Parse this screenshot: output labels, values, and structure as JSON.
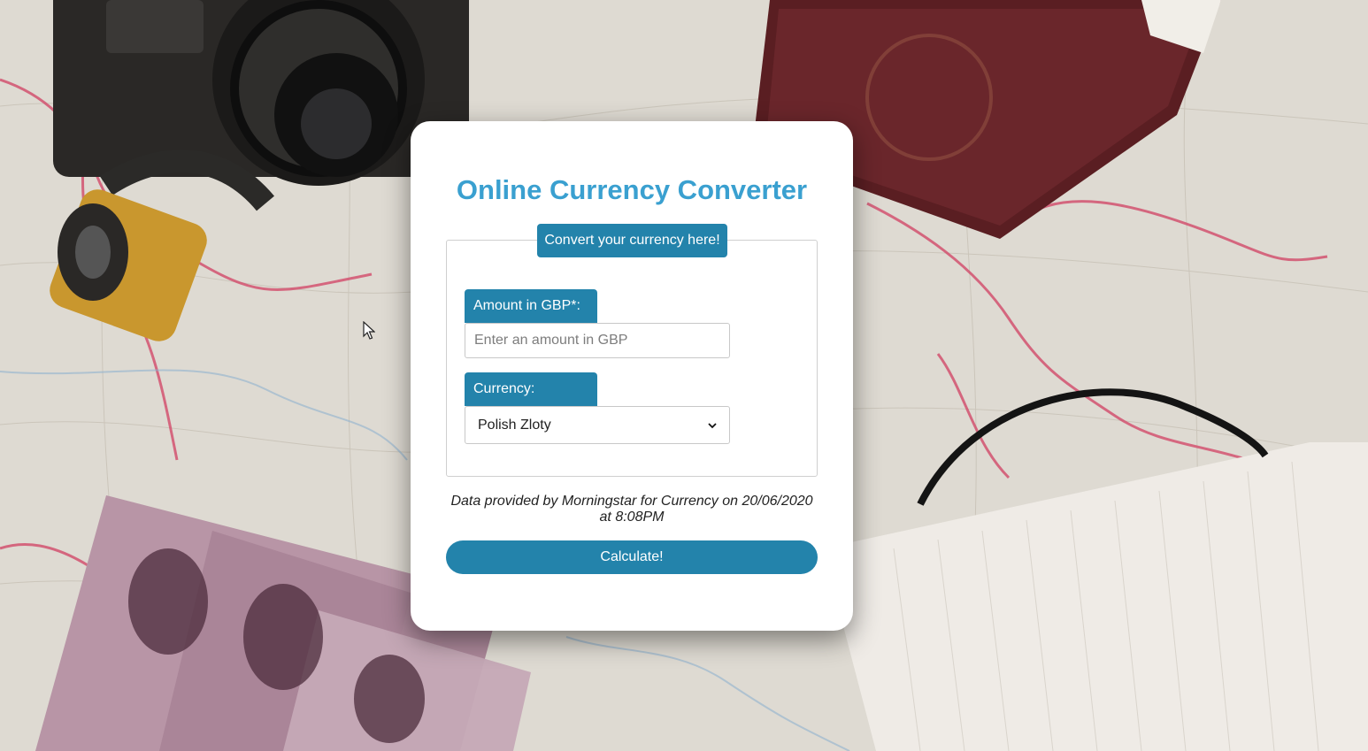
{
  "page": {
    "title": "Online Currency Converter",
    "legend": "Convert your currency here!"
  },
  "form": {
    "amount_label": "Amount in GBP*:",
    "amount_placeholder": "Enter an amount in GBP",
    "amount_value": "",
    "currency_label": "Currency:",
    "currency_selected": "Polish Zloty"
  },
  "footer": {
    "note": "Data provided by Morningstar for Currency on 20/06/2020 at 8:08PM",
    "calculate_label": "Calculate!"
  },
  "colors": {
    "title": "#3aa0d0",
    "accent": "#2383ab",
    "card": "#ffffff"
  },
  "icons": {
    "select_arrow": "chevron-down-icon",
    "cursor": "mouse-pointer-icon"
  }
}
